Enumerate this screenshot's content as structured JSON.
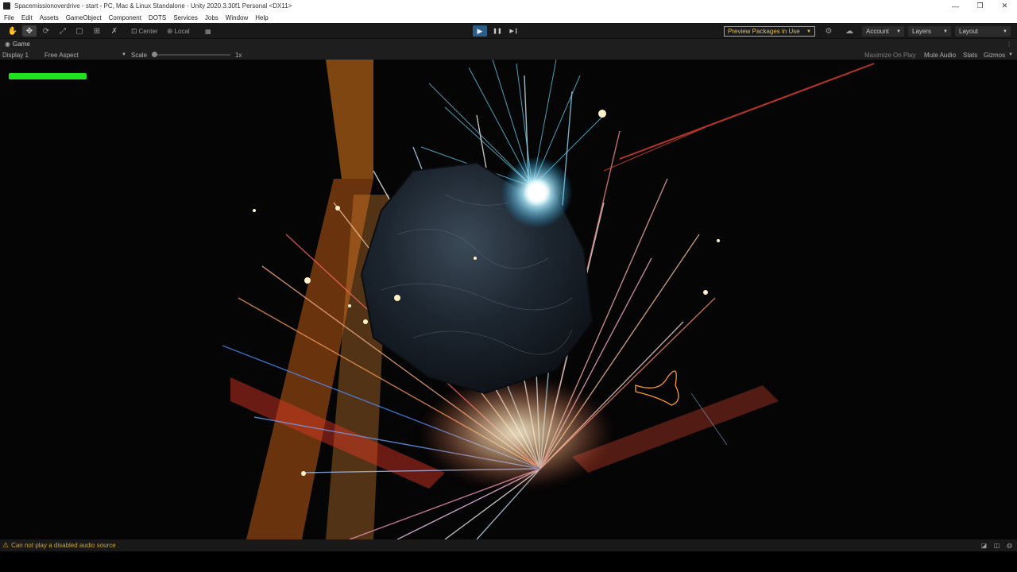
{
  "window": {
    "title": "Spacemissionoverdrive - start - PC, Mac & Linux Standalone - Unity 2020.3.30f1 Personal <DX11>",
    "minimize_glyph": "—",
    "restore_glyph": "❐",
    "close_glyph": "✕"
  },
  "menu": {
    "items": [
      "File",
      "Edit",
      "Assets",
      "GameObject",
      "Component",
      "DOTS",
      "Services",
      "Jobs",
      "Window",
      "Help"
    ]
  },
  "toolbar": {
    "tools": [
      {
        "icon": "hand-icon",
        "glyph": "✋"
      },
      {
        "icon": "move-icon",
        "glyph": "✥"
      },
      {
        "icon": "rotate-icon",
        "glyph": "⟳"
      },
      {
        "icon": "scale-icon",
        "glyph": "⤢"
      },
      {
        "icon": "rect-icon",
        "glyph": "▢"
      },
      {
        "icon": "transform-icon",
        "glyph": "⊞"
      },
      {
        "icon": "custom-tool-icon",
        "glyph": "✗"
      }
    ],
    "pivot_label": "Center",
    "space_label": "Local",
    "grid_icon_glyph": "▦",
    "play_glyph": "▶",
    "pause_glyph": "❚❚",
    "step_glyph": "▶❙",
    "preview_packages_label": "Preview Packages in Use",
    "settings_glyph": "⚙",
    "cloud_glyph": "☁",
    "account_label": "Account",
    "layers_label": "Layers",
    "layout_label": "Layout",
    "caret": "▼",
    "more_glyph": "⋮"
  },
  "game_tab": {
    "icon_glyph": "◉",
    "label": "Game",
    "menu_glyph": "⋮"
  },
  "game_toolbar": {
    "display": "Display 1",
    "aspect": "Free Aspect",
    "scale_label": "Scale",
    "scale_value": "1x",
    "maximize_label": "Maximize On Play",
    "mute_label": "Mute Audio",
    "stats_label": "Stats",
    "gizmos_label": "Gizmos",
    "caret": "▼"
  },
  "hud": {
    "health_fraction": 1.0,
    "health_color": "#1fe31f"
  },
  "status": {
    "warning_glyph": "⚠",
    "message": "Can not play a disabled audio source",
    "icons": [
      "◪",
      "◫",
      "◍"
    ]
  }
}
